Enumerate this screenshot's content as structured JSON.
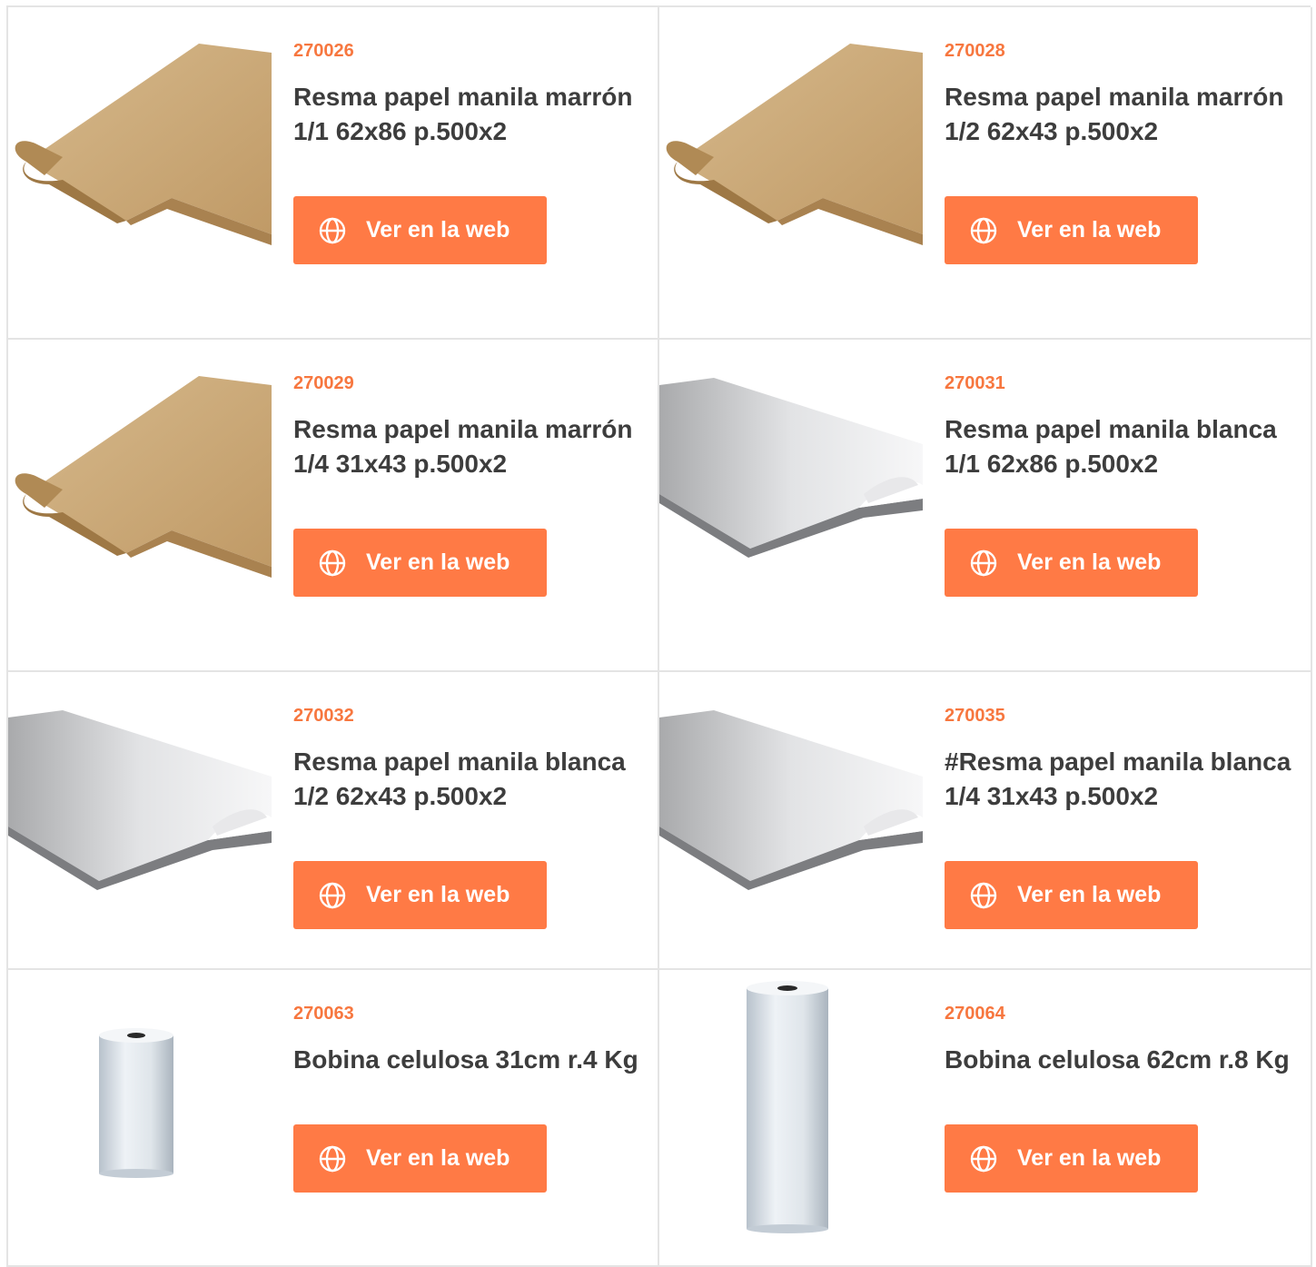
{
  "colors": {
    "accent": "#ff7a45",
    "code": "#f7773f",
    "title": "#3d3d3d",
    "border": "#e4e4e4"
  },
  "button_icon": "globe-icon",
  "products": [
    {
      "code": "270026",
      "title": "Resma papel manila marrón 1/1 62x86 p.500x2",
      "button": "Ver en la web",
      "image": "kraft-paper-ream"
    },
    {
      "code": "270028",
      "title": "Resma papel manila marrón 1/2 62x43 p.500x2",
      "button": "Ver en la web",
      "image": "kraft-paper-ream"
    },
    {
      "code": "270029",
      "title": "Resma papel manila marrón 1/4 31x43 p.500x2",
      "button": "Ver en la web",
      "image": "kraft-paper-ream"
    },
    {
      "code": "270031",
      "title": "Resma papel manila blanca 1/1 62x86 p.500x2",
      "button": "Ver en la web",
      "image": "white-paper-ream"
    },
    {
      "code": "270032",
      "title": "Resma papel manila blanca 1/2 62x43 p.500x2",
      "button": "Ver en la web",
      "image": "white-paper-ream"
    },
    {
      "code": "270035",
      "title": "#Resma papel manila blanca 1/4 31x43 p.500x2",
      "button": "Ver en la web",
      "image": "white-paper-ream"
    },
    {
      "code": "270063",
      "title": "Bobina celulosa 31cm r.4 Kg",
      "button": "Ver en la web",
      "image": "short-paper-roll"
    },
    {
      "code": "270064",
      "title": "Bobina celulosa 62cm r.8 Kg",
      "button": "Ver en la web",
      "image": "tall-paper-roll"
    }
  ]
}
